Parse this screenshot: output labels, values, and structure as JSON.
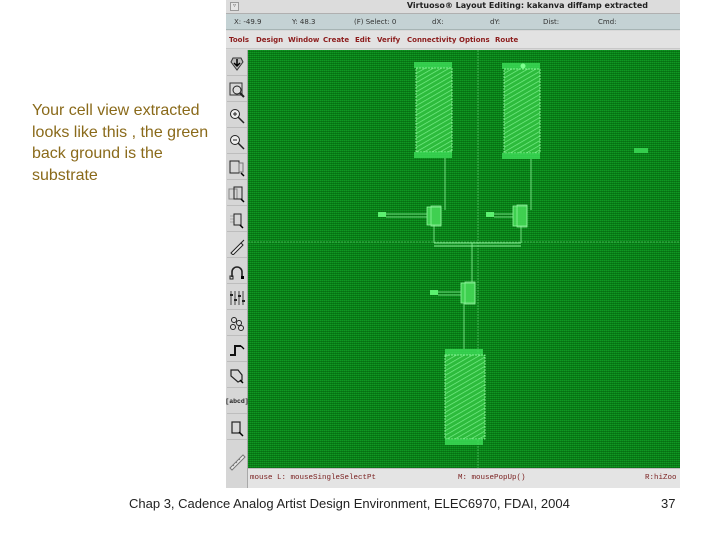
{
  "slide": {
    "caption": "Your cell view extracted looks like this , the green back ground is the substrate",
    "footer": "Chap 3, Cadence Analog Artist Design Environment, ELEC6970, FDAI, 2004",
    "page_number": "37"
  },
  "window": {
    "title": "Virtuoso® Layout Editing: kakanva diffamp extracted",
    "menu_button_glyph": "▿"
  },
  "status": {
    "x": "X: -49.9",
    "y": "Y: 48.3",
    "select": "(F) Select: 0",
    "dx": "dX:",
    "dy": "dY:",
    "dist": "Dist:",
    "cmd": "Cmd:"
  },
  "menu": {
    "items": [
      "Tools",
      "Design",
      "Window",
      "Create",
      "Edit",
      "Verify",
      "Connectivity",
      "Options",
      "Route"
    ]
  },
  "toolbar": {
    "tools": [
      {
        "icon": "save-icon"
      },
      {
        "icon": "zoom-fit-icon"
      },
      {
        "icon": "zoom-in-icon"
      },
      {
        "icon": "zoom-out-icon"
      },
      {
        "icon": "stretch-icon"
      },
      {
        "icon": "copy-icon"
      },
      {
        "icon": "move-icon"
      },
      {
        "icon": "delete-icon"
      },
      {
        "icon": "undo-icon"
      },
      {
        "icon": "properties-icon"
      },
      {
        "icon": "instance-icon"
      },
      {
        "icon": "path-icon"
      },
      {
        "icon": "polygon-icon"
      },
      {
        "icon": "label-icon",
        "text": "[abcd]"
      },
      {
        "icon": "rectangle-icon"
      },
      {
        "icon": "ruler-icon"
      }
    ]
  },
  "mouse": {
    "left": "mouse L: mouseSingleSelectPt",
    "middle": "M: mousePopUp()",
    "right": "R:hiZoo"
  },
  "colors": {
    "substrate": "#0a8a1c",
    "device": "#3fe05a",
    "caption": "#8a6a1a",
    "menu_text": "#8c1c1c"
  }
}
